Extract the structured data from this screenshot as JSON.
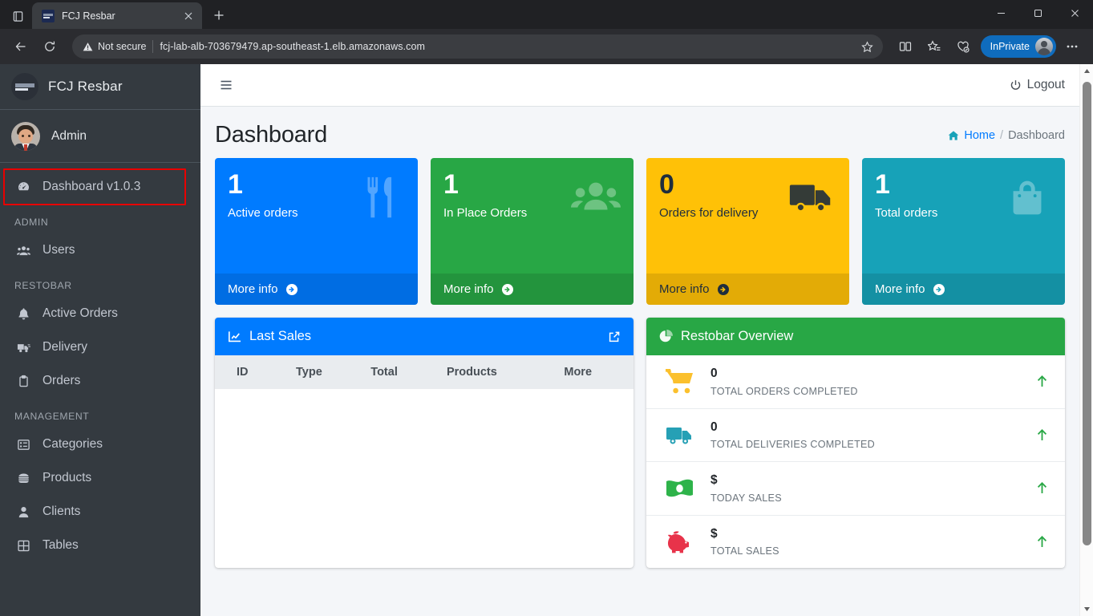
{
  "browser": {
    "tab": {
      "title": "FCJ Resbar",
      "favicon": "fcj-favicon"
    },
    "new_tab_label": "+",
    "url": "fcj-lab-alb-703679479.ap-southeast-1.elb.amazonaws.com",
    "security_label": "Not secure",
    "profile_label": "InPrivate",
    "icons": {
      "tab_search": "tab-list-icon",
      "back": "back-arrow-icon",
      "reload": "reload-icon",
      "warning": "warning-triangle-icon",
      "favorite": "star-icon",
      "split_screen": "split-screen-icon",
      "favorites_bar": "favorites-list-icon",
      "collections": "collections-icon",
      "settings_more": "ellipsis-icon",
      "minimize": "minimize-icon",
      "maximize": "maximize-icon",
      "close": "window-close-icon"
    }
  },
  "sidebar": {
    "brand": "FCJ Resbar",
    "user": "Admin",
    "active_item": {
      "label": "Dashboard v1.0.3",
      "icon": "tachometer-icon",
      "highlighted": true,
      "highlight_color": "#e80000"
    },
    "sections": [
      {
        "header": "ADMIN",
        "items": [
          {
            "label": "Users",
            "icon": "users-icon"
          }
        ]
      },
      {
        "header": "RESTOBAR",
        "items": [
          {
            "label": "Active Orders",
            "icon": "bell-icon"
          },
          {
            "label": "Delivery",
            "icon": "truck-icon"
          },
          {
            "label": "Orders",
            "icon": "clipboard-icon"
          }
        ]
      },
      {
        "header": "MANAGEMENT",
        "items": [
          {
            "label": "Categories",
            "icon": "list-box-icon"
          },
          {
            "label": "Products",
            "icon": "burger-icon"
          },
          {
            "label": "Clients",
            "icon": "user-icon"
          },
          {
            "label": "Tables",
            "icon": "grid-icon"
          }
        ]
      }
    ]
  },
  "navbar": {
    "menu_toggle": "hamburger-icon",
    "logout_label": "Logout",
    "logout_icon": "power-icon"
  },
  "page": {
    "title": "Dashboard",
    "breadcrumb": {
      "home": "Home",
      "separator": "/",
      "current": "Dashboard",
      "home_icon": "home-icon"
    }
  },
  "stat_cards": [
    {
      "value": "1",
      "label": "Active orders",
      "more": "More info",
      "icon": "cutlery-icon",
      "color": "#007bff",
      "text": "light"
    },
    {
      "value": "1",
      "label": "In Place Orders",
      "more": "More info",
      "icon": "users-group-icon",
      "color": "#28a745",
      "text": "light"
    },
    {
      "value": "0",
      "label": "Orders for delivery",
      "more": "More info",
      "icon": "delivery-truck-icon",
      "color": "#ffc107",
      "text": "dark"
    },
    {
      "value": "1",
      "label": "Total orders",
      "more": "More info",
      "icon": "shopping-bag-icon",
      "color": "#17a2b8",
      "text": "light"
    }
  ],
  "last_sales": {
    "title": "Last Sales",
    "header_color": "#007bff",
    "icon": "chart-line-icon",
    "expand_icon": "external-link-icon",
    "columns": [
      "ID",
      "Type",
      "Total",
      "Products",
      "More"
    ],
    "rows": []
  },
  "restobar_overview": {
    "title": "Restobar Overview",
    "header_color": "#28a745",
    "icon": "pie-chart-icon",
    "rows": [
      {
        "value": "0",
        "caption": "TOTAL ORDERS COMPLETED",
        "icon": "shopping-cart-icon",
        "icon_color": "#fbc02d",
        "trend": "up",
        "trend_color": "#28a745"
      },
      {
        "value": "0",
        "caption": "TOTAL DELIVERIES COMPLETED",
        "icon": "delivery-truck-icon",
        "icon_color": "#26a0b5",
        "trend": "up",
        "trend_color": "#28a745"
      },
      {
        "value": "$",
        "caption": "TODAY SALES",
        "icon": "money-bill-icon",
        "icon_color": "#2eb34a",
        "trend": "up",
        "trend_color": "#28a745"
      },
      {
        "value": "$",
        "caption": "TOTAL SALES",
        "icon": "piggy-bank-icon",
        "icon_color": "#e8334a",
        "trend": "up",
        "trend_color": "#28a745"
      }
    ]
  }
}
